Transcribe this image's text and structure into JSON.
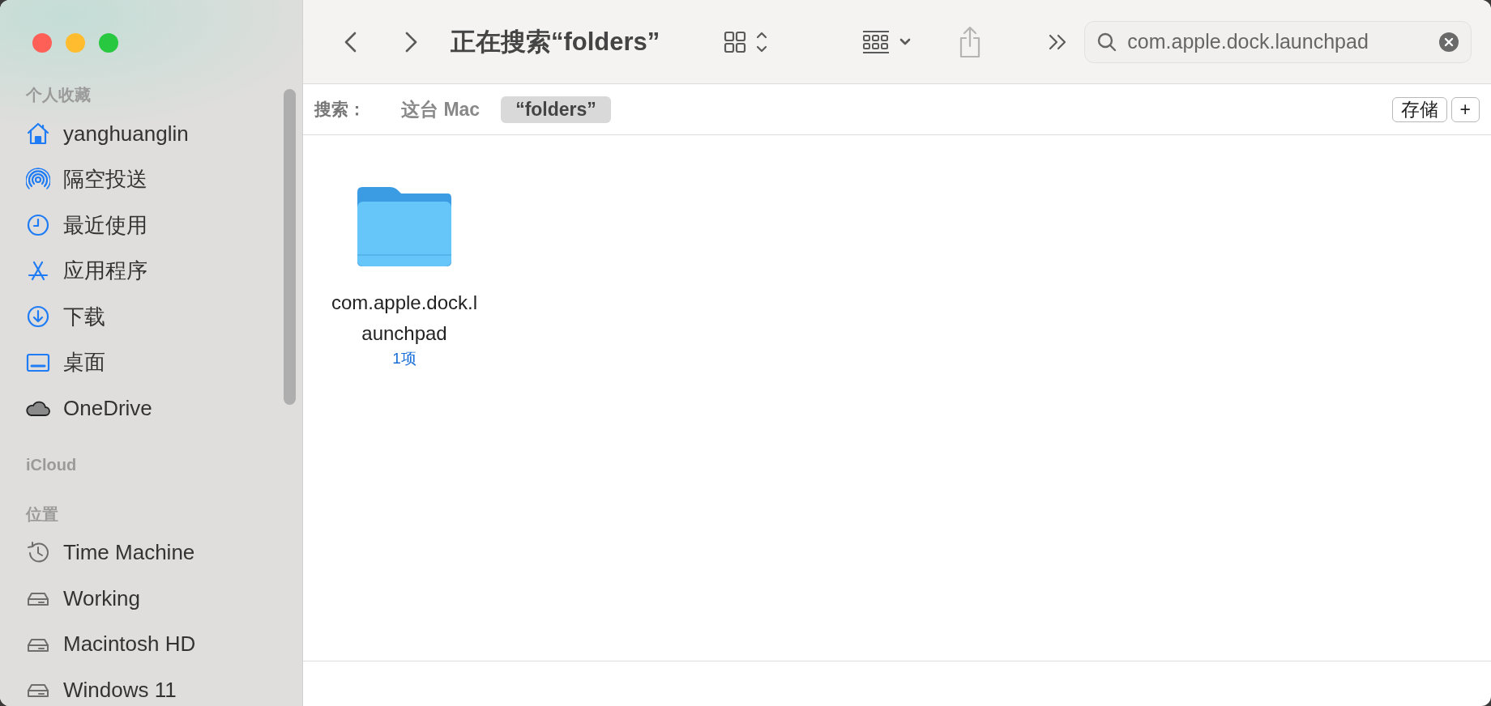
{
  "window": {
    "traffic_lights": [
      {
        "color": "#fe5f57"
      },
      {
        "color": "#febc2e"
      },
      {
        "color": "#28c840"
      }
    ]
  },
  "sidebar": {
    "sections": [
      {
        "header": "个人收藏",
        "items": [
          {
            "label": "yanghuanglin",
            "kind": "home"
          },
          {
            "label": "隔空投送",
            "kind": "airdrop"
          },
          {
            "label": "最近使用",
            "kind": "recent"
          },
          {
            "label": "应用程序",
            "kind": "apps"
          },
          {
            "label": "下载",
            "kind": "download"
          },
          {
            "label": "桌面",
            "kind": "desktop"
          },
          {
            "label": "OneDrive",
            "kind": "cloud"
          }
        ]
      },
      {
        "header": "iCloud"
      },
      {
        "header": "位置",
        "items": [
          {
            "label": "Time Machine",
            "kind": "timemachine"
          },
          {
            "label": "Working",
            "kind": "drive"
          },
          {
            "label": "Macintosh HD",
            "kind": "drive"
          },
          {
            "label": "Windows 11",
            "kind": "drive"
          }
        ]
      }
    ]
  },
  "toolbar": {
    "title": "正在搜索“folders”",
    "search": {
      "value": "com.apple.dock.launchpad"
    },
    "share_disabled": true
  },
  "scope_bar": {
    "label": "搜索：",
    "scopes": [
      {
        "label": "这台 Mac",
        "selected": false
      },
      {
        "label": "“folders”",
        "selected": true
      }
    ],
    "buttons": [
      "存储",
      "+"
    ]
  },
  "items": [
    {
      "name_lines": [
        "com.apple.dock.l",
        "aunchpad"
      ],
      "info": "1项"
    }
  ]
}
